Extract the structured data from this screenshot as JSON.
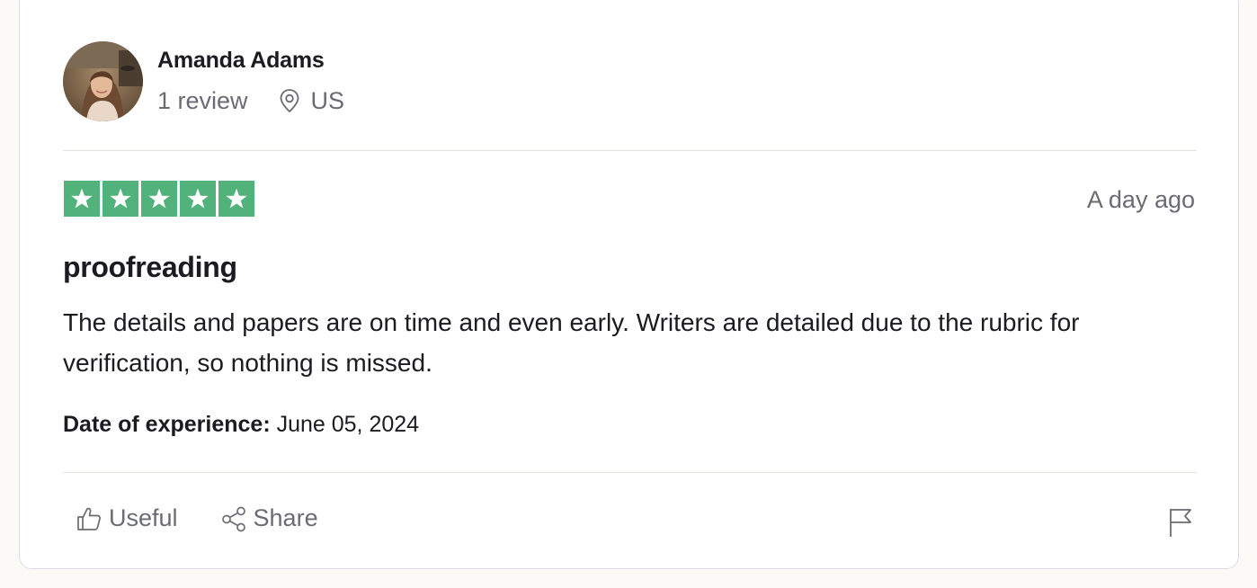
{
  "reviewer": {
    "name": "Amanda Adams",
    "review_count": "1 review",
    "location": "US"
  },
  "review": {
    "rating": 5,
    "rating_max": 5,
    "posted": "A day ago",
    "title": "proofreading",
    "body": "The details and papers are on time and even early. Writers are detailed due to the rubric for verification, so nothing is missed.",
    "experience_label": "Date of experience:",
    "experience_date": "June 05, 2024"
  },
  "actions": {
    "useful_label": "Useful",
    "share_label": "Share"
  },
  "colors": {
    "star_green": "#51b27b",
    "text_muted": "#6b6b74",
    "text_primary": "#1b1b21"
  },
  "icons": [
    "location-pin-icon",
    "star-icon",
    "thumbs-up-icon",
    "share-icon",
    "flag-icon"
  ]
}
